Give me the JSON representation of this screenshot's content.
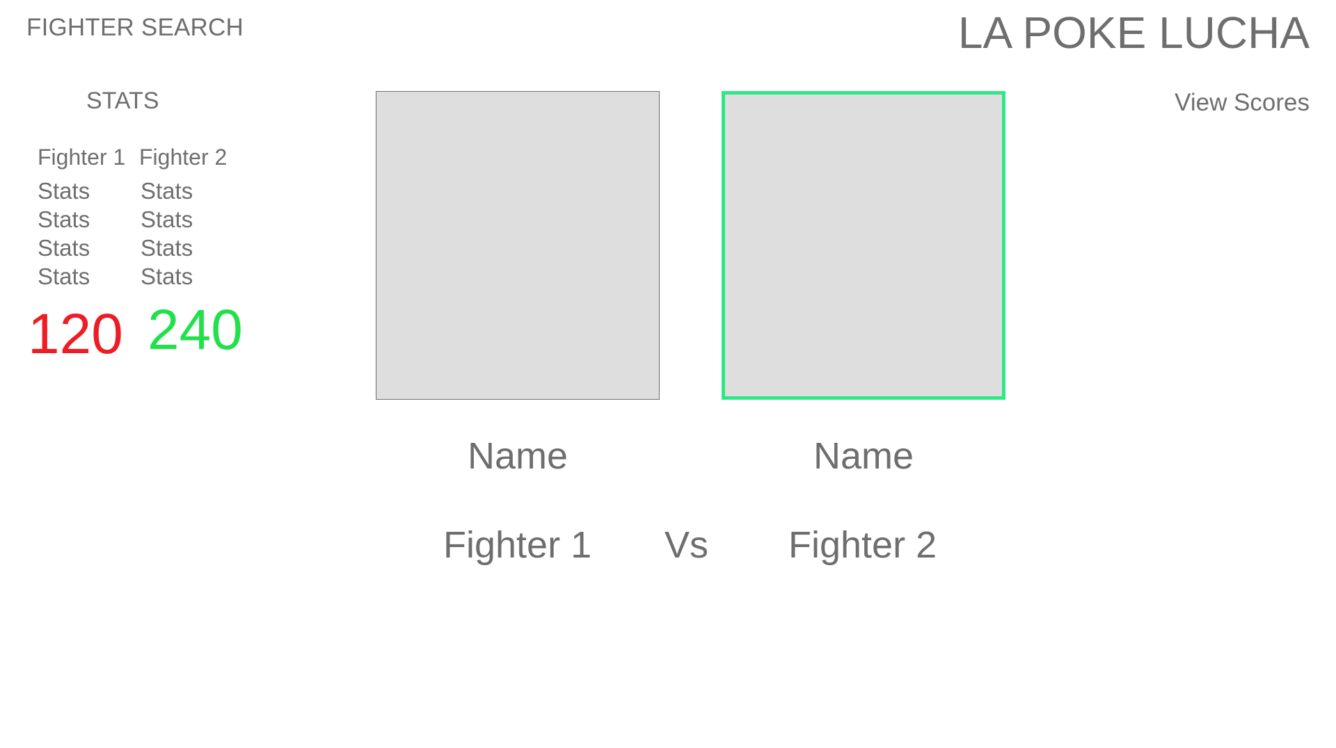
{
  "header": {
    "fighter_search_label": "FIGHTER SEARCH",
    "app_title": "LA POKE LUCHA",
    "view_scores_label": "View Scores"
  },
  "stats": {
    "heading": "STATS",
    "columns": [
      {
        "header": "Fighter 1",
        "rows": [
          "Stats",
          "Stats",
          "Stats",
          "Stats"
        ],
        "score": "120",
        "score_color": "#ee1c24"
      },
      {
        "header": "Fighter 2",
        "rows": [
          "Stats",
          "Stats",
          "Stats",
          "Stats"
        ],
        "score": "240",
        "score_color": "#22e04c"
      }
    ]
  },
  "fighters": [
    {
      "name": "Name",
      "label": "Fighter 1",
      "selected": false
    },
    {
      "name": "Name",
      "label": "Fighter 2",
      "selected": true,
      "highlight_color": "#2ee886"
    }
  ],
  "versus_label": "Vs"
}
